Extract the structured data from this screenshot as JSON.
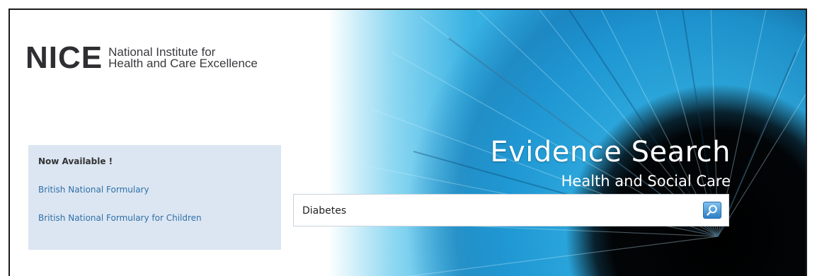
{
  "brand": {
    "logo_mark": "NICE",
    "logo_line1": "National Institute for",
    "logo_line2": "Health and Care Excellence"
  },
  "hero": {
    "title": "Evidence Search",
    "subtitle": "Health and Social Care"
  },
  "search": {
    "value": "Diabetes",
    "button_icon": "magnifier-icon"
  },
  "sidebar": {
    "heading": "Now Available !",
    "links": [
      "British National Formulary",
      "British National Formulary for Children"
    ]
  },
  "colors": {
    "panel_background": "#dce6f2",
    "link": "#2f6fa8",
    "brand_text": "#2f2f33",
    "accent_blue": "#1c8fcf"
  }
}
